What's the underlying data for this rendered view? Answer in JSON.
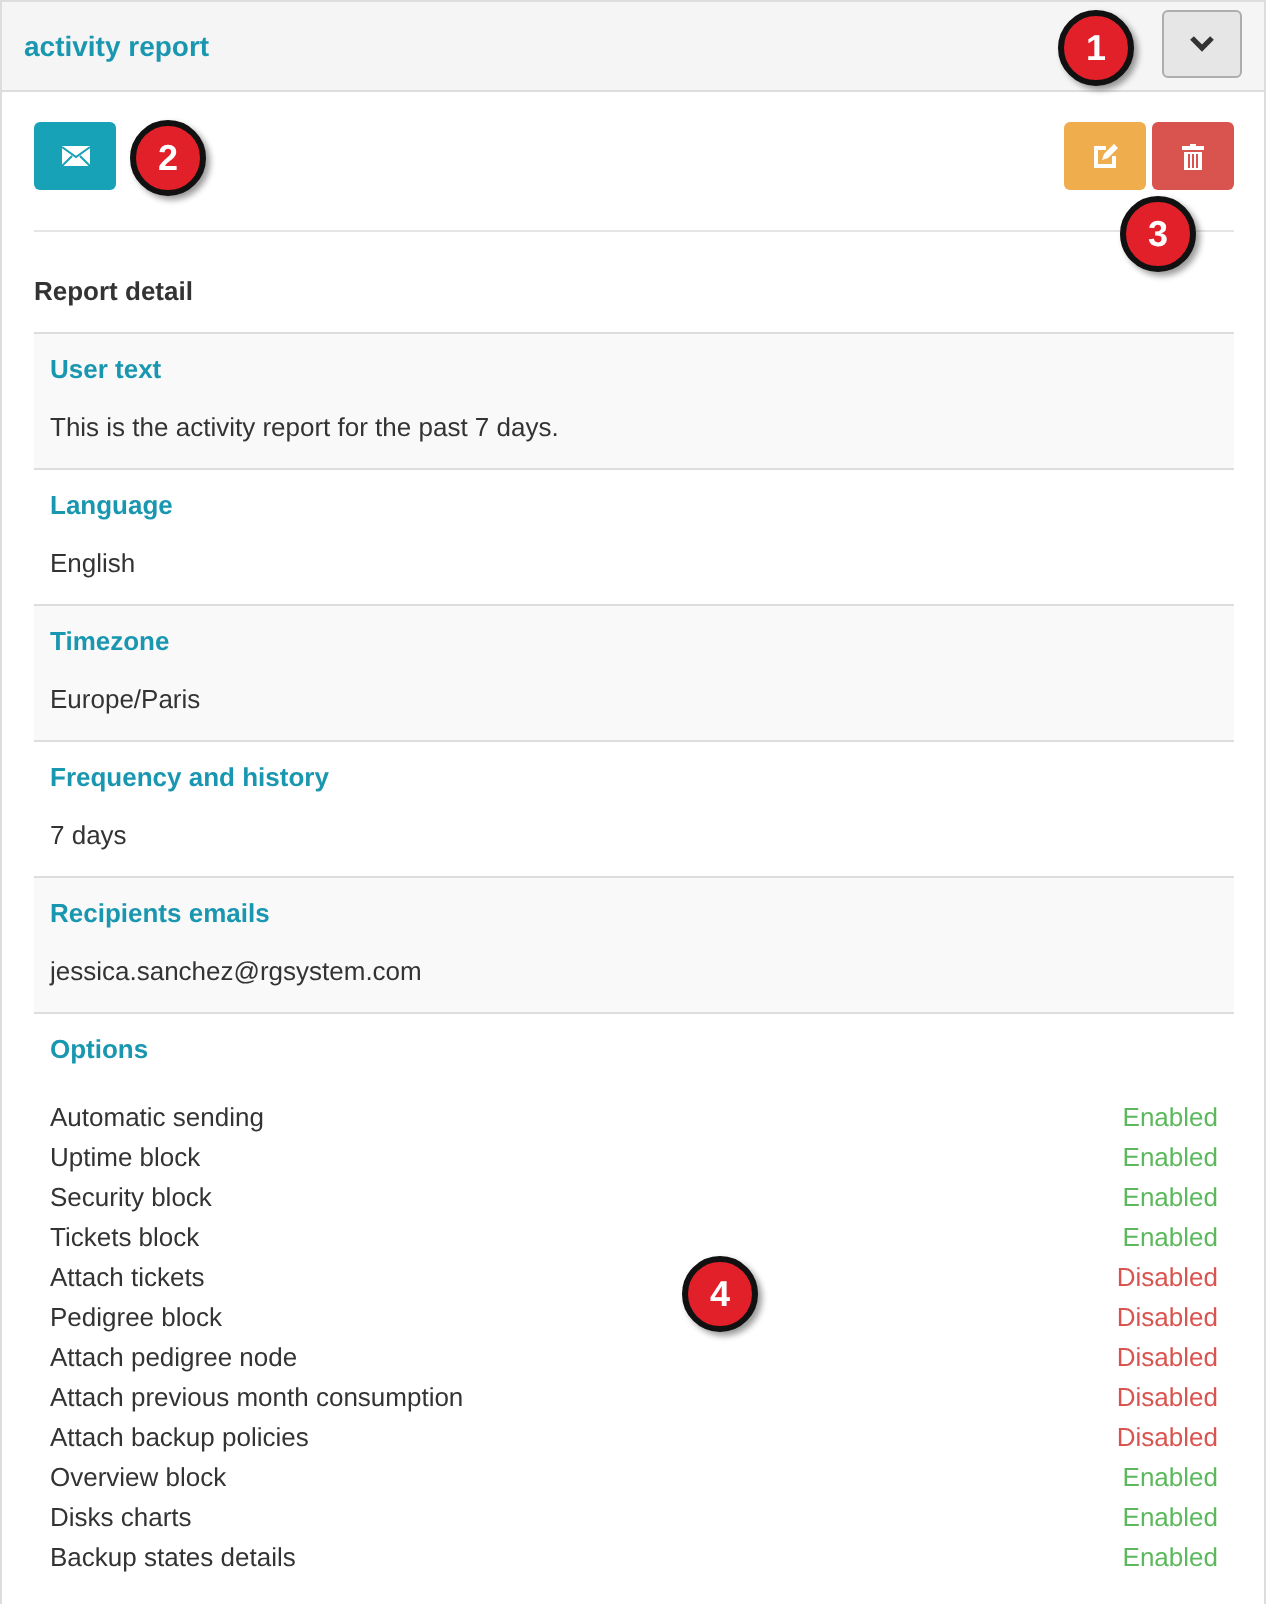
{
  "panel": {
    "title": "activity report"
  },
  "callouts": [
    "1",
    "2",
    "3",
    "4"
  ],
  "section_title": "Report detail",
  "details": [
    {
      "label": "User text",
      "value": "This is the activity report for the past 7 days."
    },
    {
      "label": "Language",
      "value": "English"
    },
    {
      "label": "Timezone",
      "value": "Europe/Paris"
    },
    {
      "label": "Frequency and history",
      "value": "7 days"
    },
    {
      "label": "Recipients emails",
      "value": "jessica.sanchez@rgsystem.com"
    }
  ],
  "options": {
    "label": "Options",
    "items": [
      {
        "name": "Automatic sending",
        "status": "Enabled",
        "enabled": true
      },
      {
        "name": "Uptime block",
        "status": "Enabled",
        "enabled": true
      },
      {
        "name": "Security block",
        "status": "Enabled",
        "enabled": true
      },
      {
        "name": "Tickets block",
        "status": "Enabled",
        "enabled": true
      },
      {
        "name": "Attach tickets",
        "status": "Disabled",
        "enabled": false
      },
      {
        "name": "Pedigree block",
        "status": "Disabled",
        "enabled": false
      },
      {
        "name": "Attach pedigree node",
        "status": "Disabled",
        "enabled": false
      },
      {
        "name": "Attach previous month consumption",
        "status": "Disabled",
        "enabled": false
      },
      {
        "name": "Attach backup policies",
        "status": "Disabled",
        "enabled": false
      },
      {
        "name": "Overview block",
        "status": "Enabled",
        "enabled": true
      },
      {
        "name": "Disks charts",
        "status": "Enabled",
        "enabled": true
      },
      {
        "name": "Backup states details",
        "status": "Enabled",
        "enabled": true
      }
    ]
  }
}
